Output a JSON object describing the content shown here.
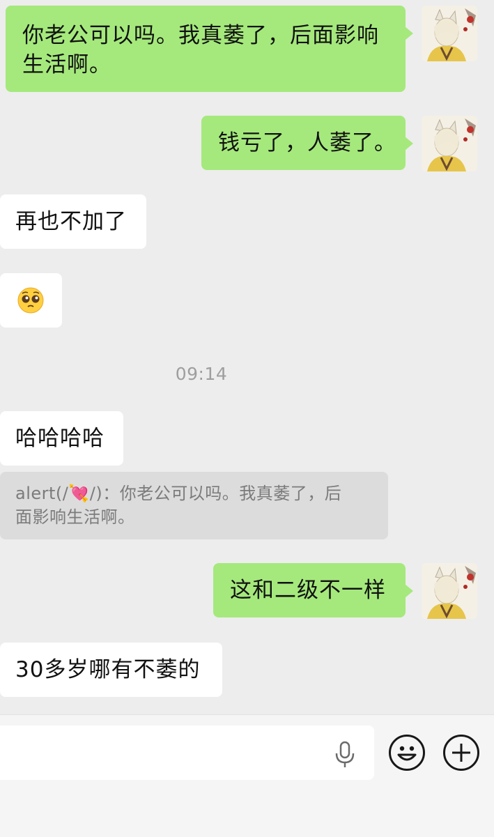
{
  "messages": [
    {
      "side": "self",
      "text_line1": "你老公可以吗。我真萎了，后面影响",
      "text_line2": "生活啊。"
    },
    {
      "side": "self",
      "text": "钱亏了，人萎了。"
    },
    {
      "side": "other",
      "text": "再也不加了"
    },
    {
      "side": "other",
      "emoji": "🥺"
    },
    {
      "side": "other",
      "text": "哈哈哈哈"
    },
    {
      "side": "self",
      "text": "这和二级不一样"
    },
    {
      "side": "other",
      "text": "30多岁哪有不萎的"
    }
  ],
  "timestamp": "09:14",
  "quote": {
    "line1": "alert(/💘/)：你老公可以吗。我真萎了，后",
    "line2": "面影响生活啊。"
  },
  "input": {
    "placeholder": "",
    "value": ""
  },
  "icons": {
    "mic": "microphone-icon",
    "emoji": "smiley-icon",
    "plus": "plus-circle-icon"
  },
  "colors": {
    "self_bubble": "#a5e97c",
    "other_bubble": "#ffffff",
    "background": "#ededed"
  }
}
